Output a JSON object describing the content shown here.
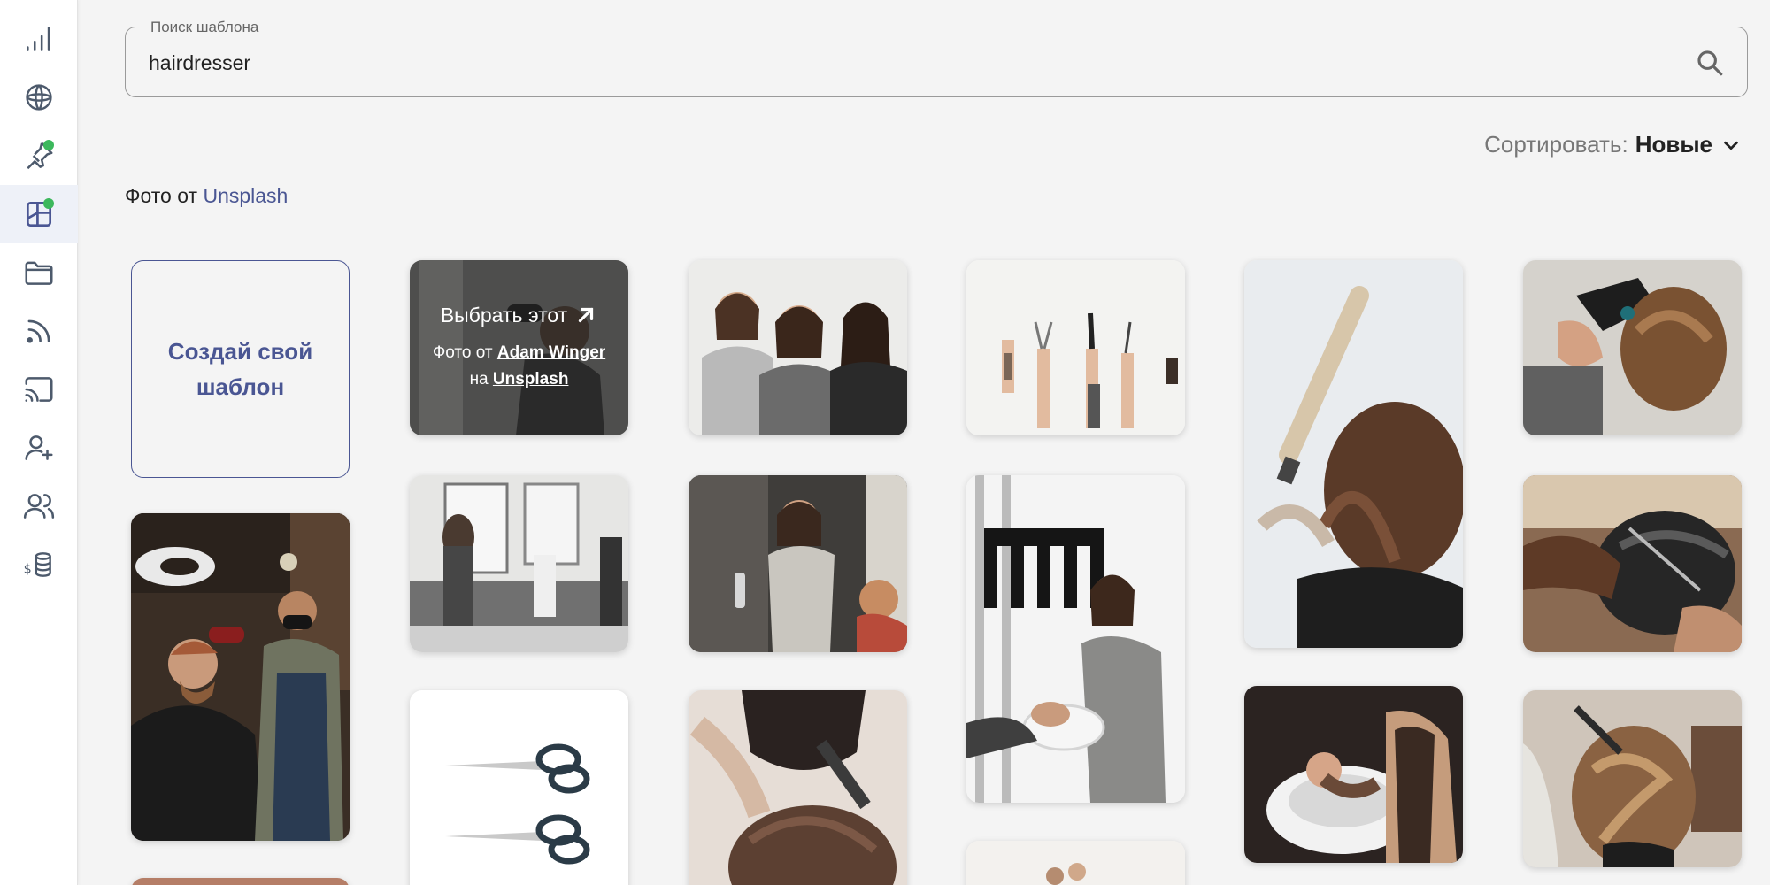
{
  "sidebar": {
    "items": [
      {
        "name": "analytics-icon",
        "active": false,
        "dot": false
      },
      {
        "name": "ai-icon",
        "active": false,
        "dot": false
      },
      {
        "name": "pin-icon",
        "active": false,
        "dot": true
      },
      {
        "name": "templates-icon",
        "active": true,
        "dot": true
      },
      {
        "name": "folder-icon",
        "active": false,
        "dot": false
      },
      {
        "name": "rss-icon",
        "active": false,
        "dot": false
      },
      {
        "name": "cast-icon",
        "active": false,
        "dot": false
      },
      {
        "name": "add-user-icon",
        "active": false,
        "dot": false
      },
      {
        "name": "users-icon",
        "active": false,
        "dot": false
      },
      {
        "name": "billing-icon",
        "active": false,
        "dot": false
      }
    ]
  },
  "search": {
    "legend": "Поиск шаблона",
    "value": "hairdresser",
    "icon": "search-icon"
  },
  "sort": {
    "label": "Сортировать:",
    "value": "Новые"
  },
  "credit": {
    "prefix": "Фото от",
    "source": "Unsplash"
  },
  "create_card": {
    "label": "Создай свой шаблон"
  },
  "hover_overlay": {
    "choose": "Выбрать этот",
    "photo_by_prefix": "Фото от",
    "author": "Adam Winger",
    "on_prefix": "на",
    "source": "Unsplash"
  },
  "colors": {
    "accent": "#4a5693",
    "status_dot": "#3cb85c",
    "background": "#f4f4f4"
  }
}
